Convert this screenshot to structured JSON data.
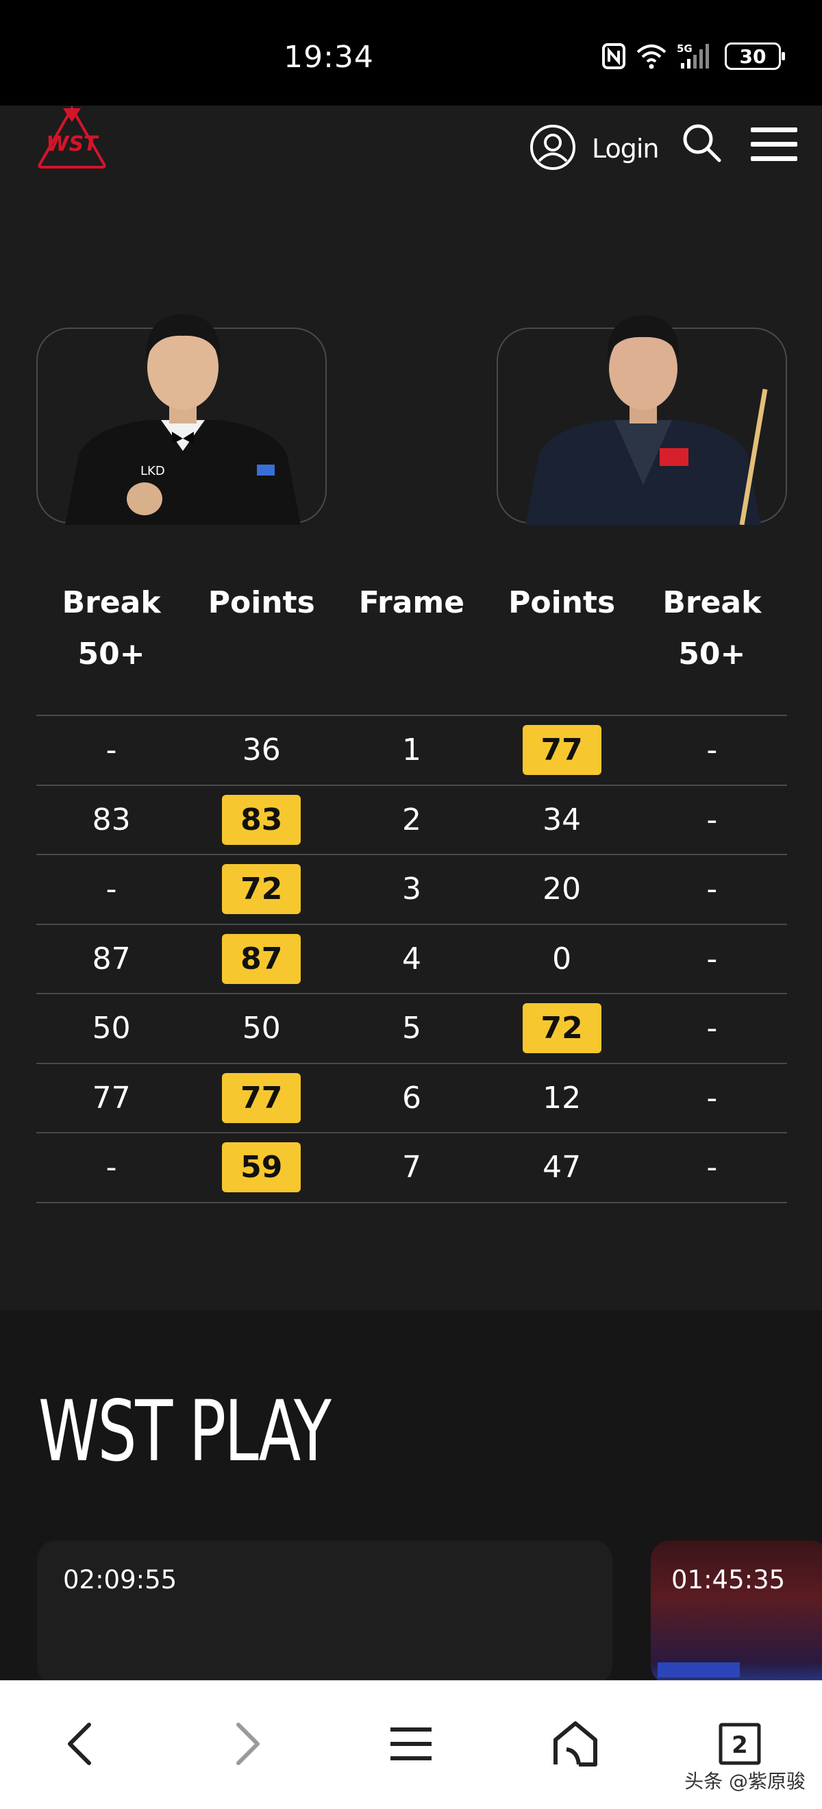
{
  "status_bar": {
    "time": "19:34",
    "network": "5G",
    "battery": "30",
    "icons": [
      "nfc-icon",
      "wifi-icon",
      "signal-icon",
      "battery-icon"
    ]
  },
  "header": {
    "logo_text": "WST",
    "login_label": "Login",
    "icons": [
      "user-circle-icon",
      "search-icon",
      "hamburger-menu-icon"
    ]
  },
  "scoreboard": {
    "columns": [
      "Break\n50+",
      "Points",
      "Frame",
      "Points",
      "Break\n50+"
    ],
    "rows": [
      {
        "break_left": "-",
        "points_left": "36",
        "frame": "1",
        "points_right": "77",
        "break_right": "-",
        "winner": "right"
      },
      {
        "break_left": "83",
        "points_left": "83",
        "frame": "2",
        "points_right": "34",
        "break_right": "-",
        "winner": "left"
      },
      {
        "break_left": "-",
        "points_left": "72",
        "frame": "3",
        "points_right": "20",
        "break_right": "-",
        "winner": "left"
      },
      {
        "break_left": "87",
        "points_left": "87",
        "frame": "4",
        "points_right": "0",
        "break_right": "-",
        "winner": "left"
      },
      {
        "break_left": "50",
        "points_left": "50",
        "frame": "5",
        "points_right": "72",
        "break_right": "-",
        "winner": "right"
      },
      {
        "break_left": "77",
        "points_left": "77",
        "frame": "6",
        "points_right": "12",
        "break_right": "-",
        "winner": "left"
      },
      {
        "break_left": "-",
        "points_left": "59",
        "frame": "7",
        "points_right": "47",
        "break_right": "-",
        "winner": "left"
      }
    ],
    "highlight_color": "#f7c72f"
  },
  "wst_play": {
    "title": "WST PLAY",
    "videos": [
      {
        "duration": "02:09:55"
      },
      {
        "duration": "01:45:35"
      }
    ]
  },
  "browser_nav": {
    "tab_count": "2",
    "icons": [
      "back-arrow-icon",
      "forward-arrow-icon",
      "menu-lines-icon",
      "home-icon",
      "tabs-icon"
    ]
  },
  "watermark": "头条 @紫原骏",
  "colors": {
    "background": "#1c1c1c",
    "accent_yellow": "#f7c72f",
    "logo_red": "#d4142a"
  }
}
